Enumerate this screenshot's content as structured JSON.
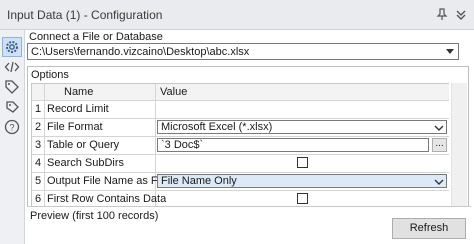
{
  "window": {
    "title": "Input Data (1) - Configuration"
  },
  "sidebar": {
    "items": [
      {
        "icon": "gear-icon"
      },
      {
        "icon": "code-icon"
      },
      {
        "icon": "tag-outline-icon"
      },
      {
        "icon": "tag-icon"
      },
      {
        "icon": "help-icon"
      }
    ]
  },
  "connect": {
    "label": "Connect a File or Database",
    "value": "C:\\Users\\fernando.vizcaino\\Desktop\\abc.xlsx"
  },
  "options": {
    "label": "Options",
    "columns": {
      "name": "Name",
      "value": "Value"
    },
    "rows": [
      {
        "num": "1",
        "name": "Record Limit",
        "value": ""
      },
      {
        "num": "2",
        "name": "File Format",
        "value": "Microsoft Excel (*.xlsx)"
      },
      {
        "num": "3",
        "name": "Table or Query",
        "value": "`3 Doc$`",
        "button": "..."
      },
      {
        "num": "4",
        "name": "Search SubDirs",
        "value": ""
      },
      {
        "num": "5",
        "name": "Output File Name as Field",
        "value": "File Name Only"
      },
      {
        "num": "6",
        "name": "First Row Contains Data",
        "value": ""
      }
    ]
  },
  "preview": {
    "label": "Preview (first 100 records)",
    "refresh": "Refresh"
  },
  "colors": {
    "accent": "#cfe0f3",
    "annotation": "#000000"
  }
}
